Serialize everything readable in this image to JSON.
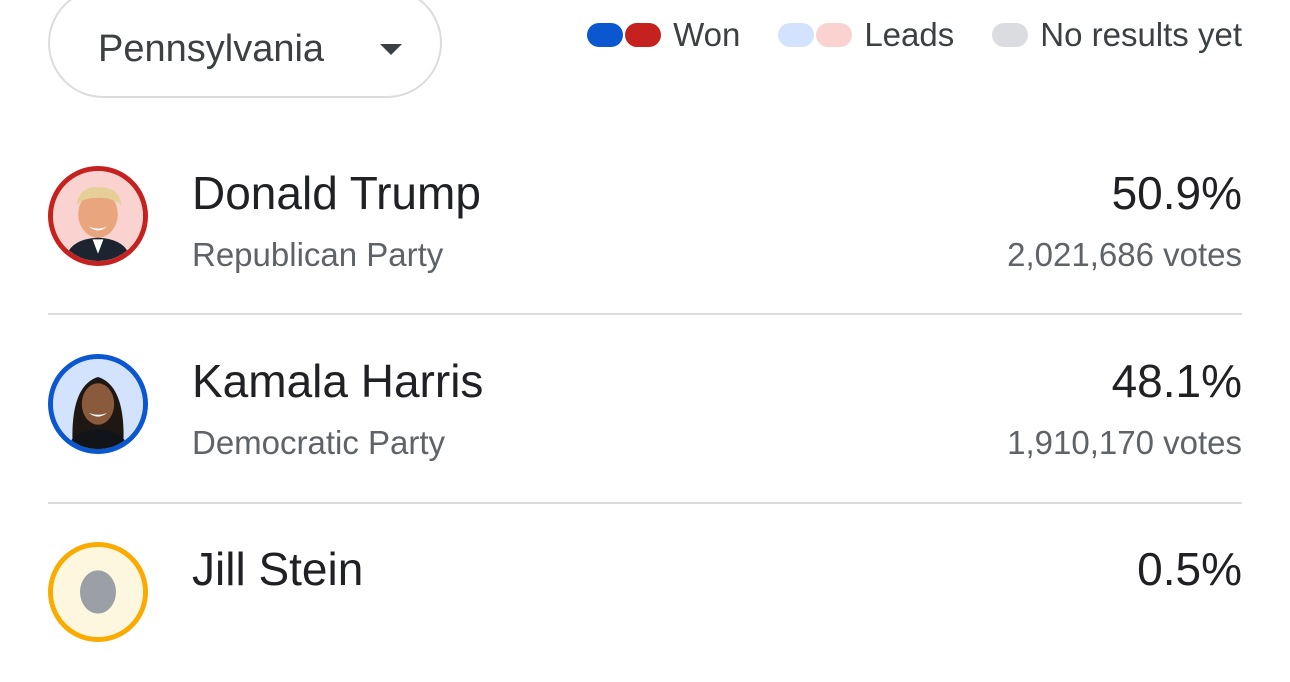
{
  "state_selector": {
    "value": "Pennsylvania"
  },
  "legend": {
    "won_label": "Won",
    "leads_label": "Leads",
    "no_results_label": "No results yet"
  },
  "colors": {
    "republican_won": "#c5221f",
    "democrat_won": "#0b57d0",
    "republican_leads": "#fad2cf",
    "democrat_leads": "#d3e3fd",
    "no_results": "#dadce0"
  },
  "candidates": [
    {
      "name": "Donald Trump",
      "party": "Republican Party",
      "percent": "50.9%",
      "votes": "2,021,686 votes"
    },
    {
      "name": "Kamala Harris",
      "party": "Democratic Party",
      "percent": "48.1%",
      "votes": "1,910,170 votes"
    },
    {
      "name": "Jill Stein",
      "party": "",
      "percent": "0.5%",
      "votes": ""
    }
  ]
}
